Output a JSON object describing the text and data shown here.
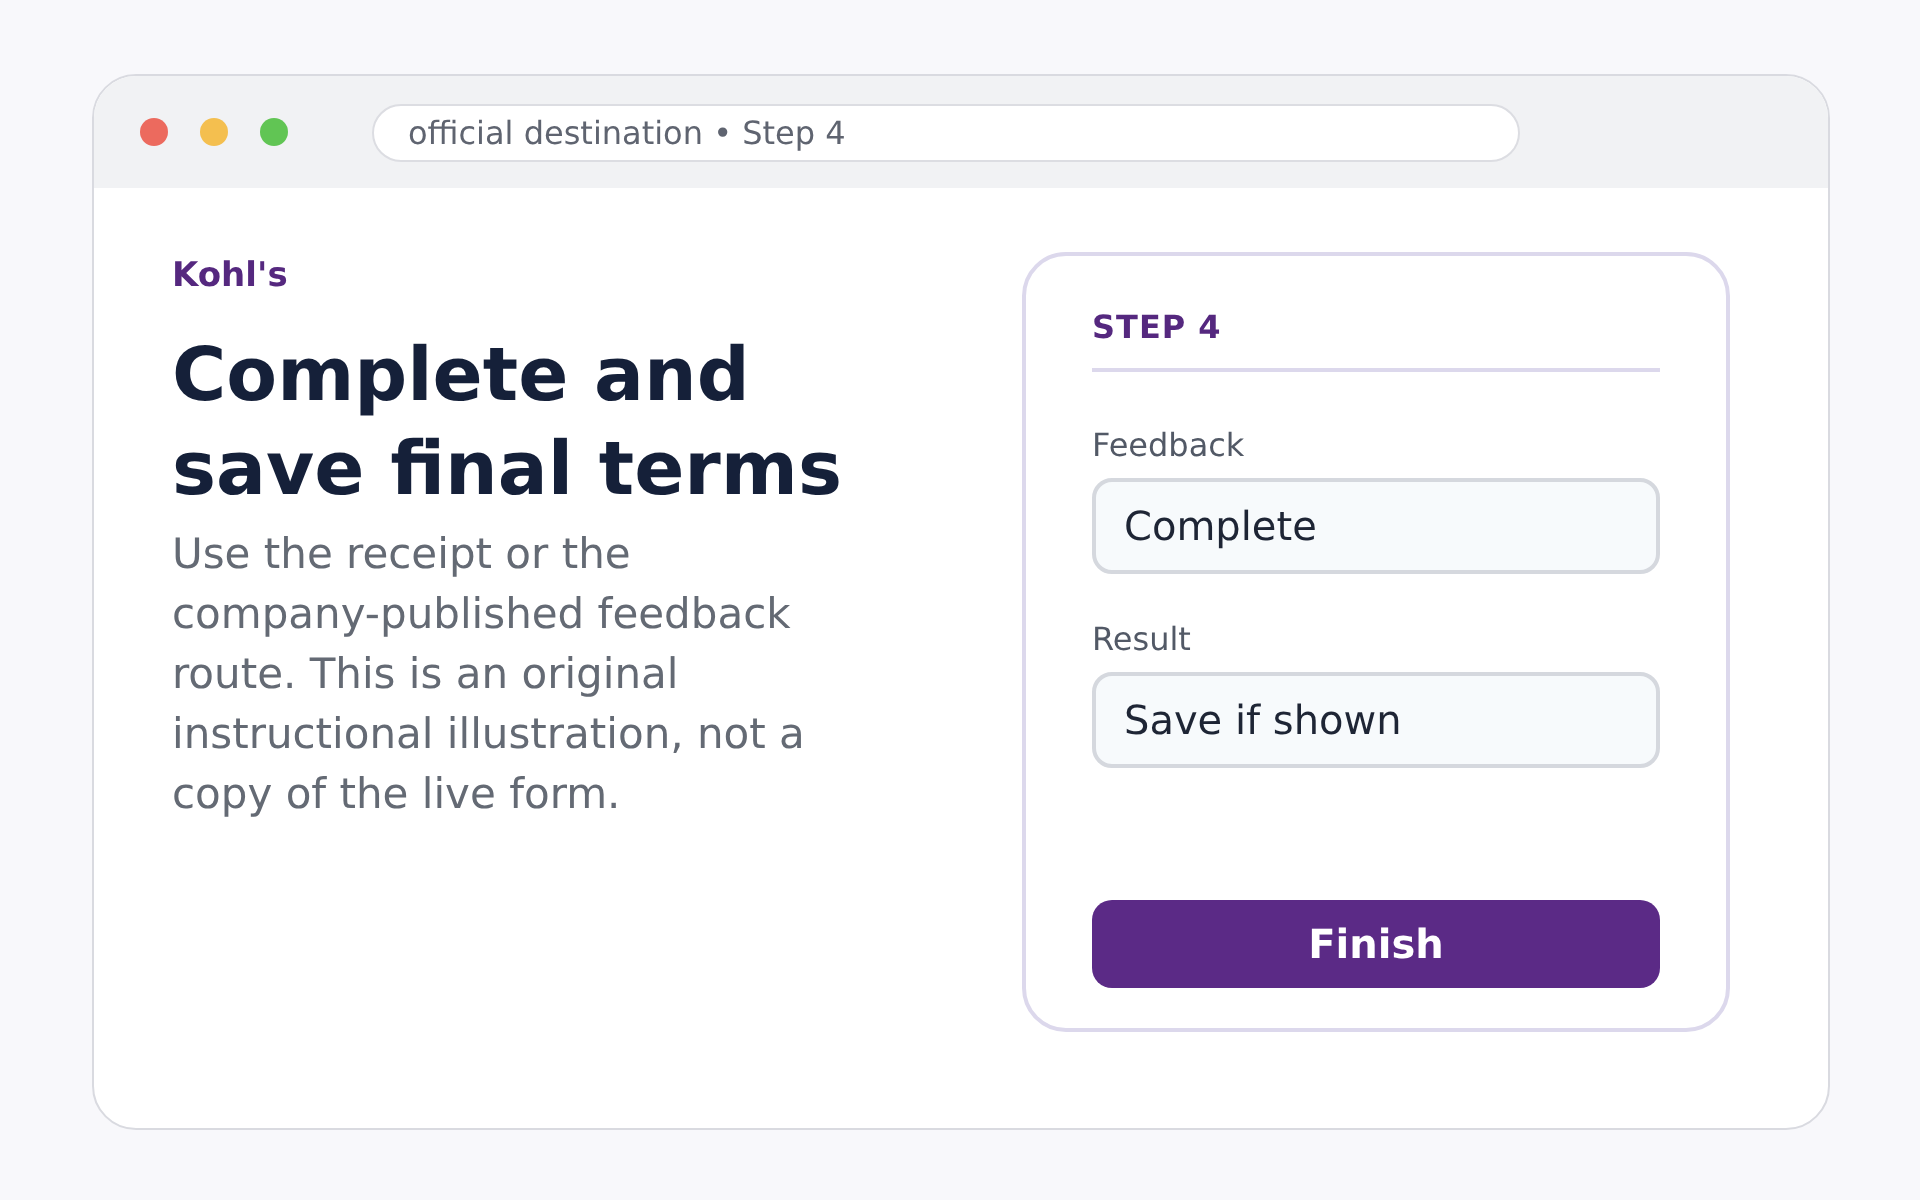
{
  "window": {
    "address": "official destination • Step 4"
  },
  "intro": {
    "brand": "Kohl's",
    "heading": "Complete and save final terms",
    "body": "Use the receipt or the company-published feedback route. This is an original instructional illustration, not a copy of the live form."
  },
  "card": {
    "step": "STEP 4",
    "fields": [
      {
        "label": "Feedback",
        "value": "Complete"
      },
      {
        "label": "Result",
        "value": "Save if shown"
      }
    ],
    "button": "Finish"
  }
}
